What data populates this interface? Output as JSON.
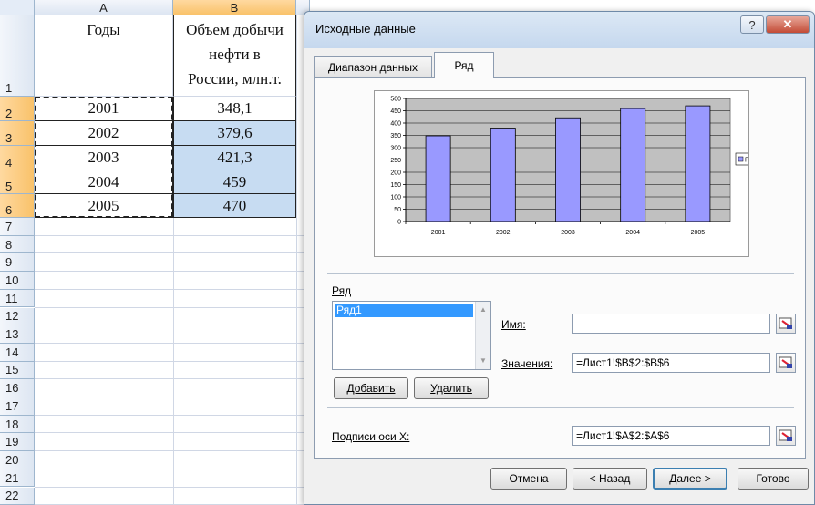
{
  "sheet": {
    "columns": [
      "A",
      "B"
    ],
    "header_row": {
      "row_number": "1",
      "col_a": "Годы",
      "col_b_lines": [
        "Объем добычи",
        "нефти в",
        "России, млн.т."
      ]
    },
    "rows": [
      {
        "num": "2",
        "year": "2001",
        "value": "348,1"
      },
      {
        "num": "3",
        "year": "2002",
        "value": "379,6"
      },
      {
        "num": "4",
        "year": "2003",
        "value": "421,3"
      },
      {
        "num": "5",
        "year": "2004",
        "value": "459"
      },
      {
        "num": "6",
        "year": "2005",
        "value": "470"
      }
    ],
    "empty_rows": [
      "7",
      "8",
      "9",
      "10",
      "11",
      "12",
      "13",
      "14",
      "15",
      "16",
      "17",
      "18",
      "19",
      "20",
      "21",
      "22"
    ]
  },
  "dialog": {
    "title": "Исходные данные",
    "help_label": "?",
    "close_label": "✕",
    "tabs": [
      {
        "label": "Диапазон данных",
        "active": false
      },
      {
        "label": "Ряд",
        "active": true
      }
    ],
    "series_group_label": "Ряд",
    "series_list": [
      "Ряд1"
    ],
    "add_button": "Добавить",
    "delete_button": "Удалить",
    "name_label": "Имя:",
    "name_value": "",
    "values_label": "Значения:",
    "values_value": "=Лист1!$B$2:$B$6",
    "x_labels_label": "Подписи оси X:",
    "x_labels_value": "=Лист1!$A$2:$A$6",
    "buttons": {
      "cancel": "Отмена",
      "back": "< Назад",
      "next": "Далее >",
      "finish": "Готово"
    }
  },
  "chart_data": {
    "type": "bar",
    "categories": [
      "2001",
      "2002",
      "2003",
      "2004",
      "2005"
    ],
    "series": [
      {
        "name": "Ряд1",
        "values": [
          348.1,
          379.6,
          421.3,
          459,
          470
        ]
      }
    ],
    "title": "",
    "xlabel": "",
    "ylabel": "",
    "ylim": [
      0,
      500
    ],
    "yticks": [
      "0",
      "50",
      "100",
      "150",
      "200",
      "250",
      "300",
      "350",
      "400",
      "450",
      "500"
    ],
    "grid": true,
    "legend": "right",
    "colors": {
      "bar": "#9999ff",
      "plot_bg": "#c0c0c0"
    }
  }
}
